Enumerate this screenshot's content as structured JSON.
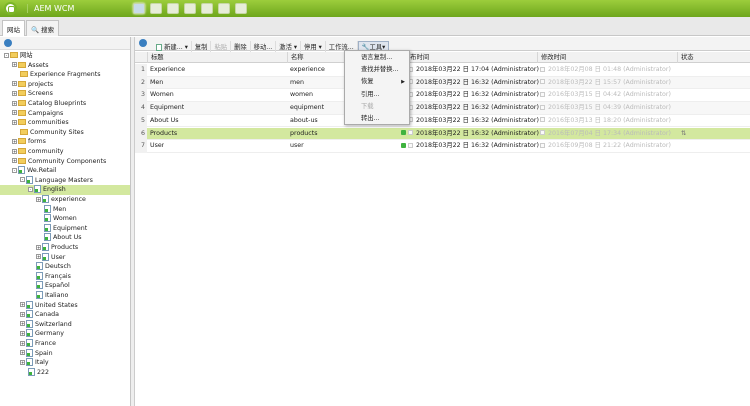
{
  "app": {
    "title": "AEM WCM",
    "nav_icons": [
      "websites-icon",
      "digital-assets-icon",
      "campaigns-icon",
      "inbox-icon",
      "users-icon",
      "tools-icon",
      "tagging-icon"
    ]
  },
  "tabs": [
    {
      "label": "网站"
    },
    {
      "label": "搜索"
    }
  ],
  "tree": [
    {
      "label": "网站",
      "lvl": 0,
      "t": "-",
      "i": "folder"
    },
    {
      "label": "Assets",
      "lvl": 1,
      "t": "+",
      "i": "folder"
    },
    {
      "label": "Experience Fragments",
      "lvl": 1,
      "t": "",
      "i": "folder"
    },
    {
      "label": "projects",
      "lvl": 1,
      "t": "+",
      "i": "folder"
    },
    {
      "label": "Screens",
      "lvl": 1,
      "t": "+",
      "i": "folder"
    },
    {
      "label": "Catalog Blueprints",
      "lvl": 1,
      "t": "+",
      "i": "folder"
    },
    {
      "label": "Campaigns",
      "lvl": 1,
      "t": "+",
      "i": "folder"
    },
    {
      "label": "communities",
      "lvl": 1,
      "t": "+",
      "i": "folder"
    },
    {
      "label": "Community Sites",
      "lvl": 1,
      "t": "",
      "i": "folder"
    },
    {
      "label": "forms",
      "lvl": 1,
      "t": "+",
      "i": "folder"
    },
    {
      "label": "community",
      "lvl": 1,
      "t": "+",
      "i": "folder"
    },
    {
      "label": "Community Components",
      "lvl": 1,
      "t": "+",
      "i": "folder"
    },
    {
      "label": "We.Retail",
      "lvl": 1,
      "t": "-",
      "i": "page"
    },
    {
      "label": "Language Masters",
      "lvl": 2,
      "t": "-",
      "i": "page"
    },
    {
      "label": "English",
      "lvl": 3,
      "t": "-",
      "i": "page",
      "sel": true
    },
    {
      "label": "experience",
      "lvl": 4,
      "t": "+",
      "i": "page"
    },
    {
      "label": "Men",
      "lvl": 4,
      "t": "",
      "i": "page"
    },
    {
      "label": "Women",
      "lvl": 4,
      "t": "",
      "i": "page"
    },
    {
      "label": "Equipment",
      "lvl": 4,
      "t": "",
      "i": "page"
    },
    {
      "label": "About Us",
      "lvl": 4,
      "t": "",
      "i": "page"
    },
    {
      "label": "Products",
      "lvl": 4,
      "t": "+",
      "i": "page"
    },
    {
      "label": "User",
      "lvl": 4,
      "t": "+",
      "i": "page"
    },
    {
      "label": "Deutsch",
      "lvl": 3,
      "t": "",
      "i": "page"
    },
    {
      "label": "Français",
      "lvl": 3,
      "t": "",
      "i": "page"
    },
    {
      "label": "Español",
      "lvl": 3,
      "t": "",
      "i": "page"
    },
    {
      "label": "Italiano",
      "lvl": 3,
      "t": "",
      "i": "page"
    },
    {
      "label": "United States",
      "lvl": 2,
      "t": "+",
      "i": "page"
    },
    {
      "label": "Canada",
      "lvl": 2,
      "t": "+",
      "i": "page"
    },
    {
      "label": "Switzerland",
      "lvl": 2,
      "t": "+",
      "i": "page"
    },
    {
      "label": "Germany",
      "lvl": 2,
      "t": "+",
      "i": "page"
    },
    {
      "label": "France",
      "lvl": 2,
      "t": "+",
      "i": "page"
    },
    {
      "label": "Spain",
      "lvl": 2,
      "t": "+",
      "i": "page"
    },
    {
      "label": "Italy",
      "lvl": 2,
      "t": "+",
      "i": "page"
    },
    {
      "label": "222",
      "lvl": 2,
      "t": "",
      "i": "page"
    }
  ],
  "toolbar": {
    "new": "新建...",
    "copy": "复制",
    "paste": "粘贴",
    "delete": "删除",
    "move": "移动...",
    "activate": "激活",
    "deactivate": "停用",
    "workflow": "工作流...",
    "tools": "工具"
  },
  "menu": [
    {
      "label": "语言复制..."
    },
    {
      "label": "查找并替换..."
    },
    {
      "label": "恢复",
      "sub": true
    },
    {
      "label": "引用..."
    },
    {
      "label": "下载",
      "disabled": true
    },
    {
      "label": "转出..."
    }
  ],
  "columns": {
    "title": "标题",
    "name": "名称",
    "published": "发布时间",
    "modified": "修改时间",
    "status": "状态"
  },
  "rows": [
    {
      "n": "1",
      "title": "Experience",
      "name": "experience",
      "pub": "2018年03月22 日 17:04 (Administrator)",
      "mod": "2018年02月08 日 01:48 (Administrator)",
      "live": false
    },
    {
      "n": "2",
      "title": "Men",
      "name": "men",
      "pub": "2018年03月22 日 16:32 (Administrator)",
      "mod": "2018年03月22 日 15:57 (Administrator)",
      "live": false
    },
    {
      "n": "3",
      "title": "Women",
      "name": "women",
      "pub": "2018年03月22 日 16:32 (Administrator)",
      "mod": "2016年03月15 日 04:42 (Administrator)",
      "live": false
    },
    {
      "n": "4",
      "title": "Equipment",
      "name": "equipment",
      "pub": "2018年03月22 日 16:32 (Administrator)",
      "mod": "2016年03月15 日 04:39 (Administrator)",
      "live": false
    },
    {
      "n": "5",
      "title": "About Us",
      "name": "about-us",
      "pub": "2018年03月22 日 16:32 (Administrator)",
      "mod": "2016年03月13 日 18:20 (Administrator)",
      "live": false
    },
    {
      "n": "6",
      "title": "Products",
      "name": "products",
      "pub": "2018年03月22 日 16:32 (Administrator)",
      "mod": "2016年07月04 日 17:34 (Administrator)",
      "live": true,
      "sel": true
    },
    {
      "n": "7",
      "title": "User",
      "name": "user",
      "pub": "2018年03月22 日 16:32 (Administrator)",
      "mod": "2016年09月08 日 21:22 (Administrator)",
      "live": true
    }
  ]
}
